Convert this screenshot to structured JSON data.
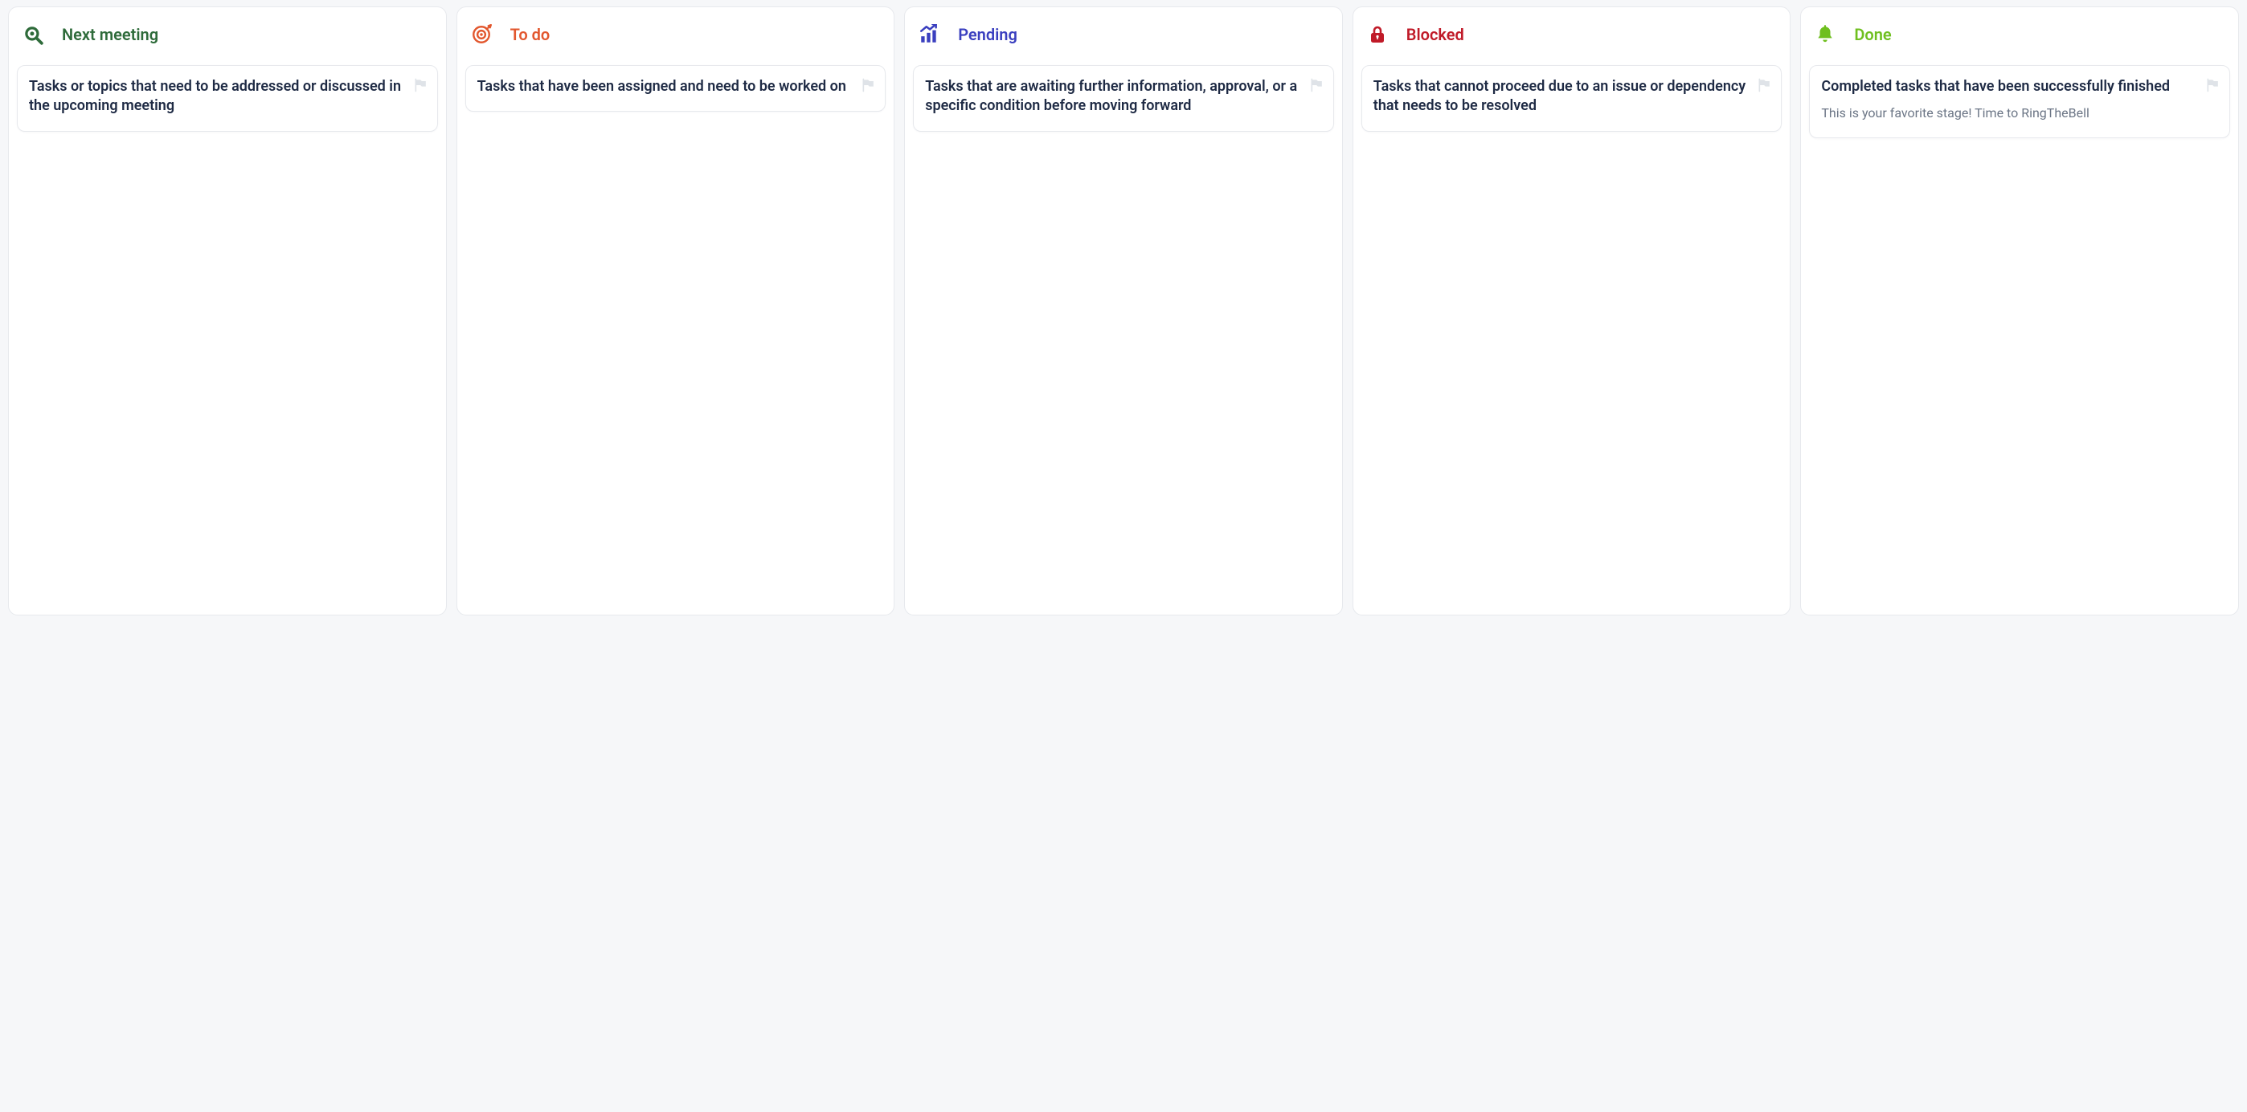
{
  "columns": [
    {
      "id": "next-meeting",
      "title": "Next meeting",
      "icon": "search-icon",
      "color": "#2e6b3a",
      "colorClass": "c-green",
      "card": {
        "title": "Tasks or topics that need to be addressed or discussed in the upcoming meeting",
        "subtitle": ""
      }
    },
    {
      "id": "to-do",
      "title": "To do",
      "icon": "target-icon",
      "color": "#e2572e",
      "colorClass": "c-orange",
      "card": {
        "title": "Tasks that have been assigned and need to be worked on",
        "subtitle": ""
      }
    },
    {
      "id": "pending",
      "title": "Pending",
      "icon": "growth-chart-icon",
      "color": "#3a3fbf",
      "colorClass": "c-blue",
      "card": {
        "title": "Tasks that are awaiting further information, approval, or a specific condition before moving forward",
        "subtitle": ""
      }
    },
    {
      "id": "blocked",
      "title": "Blocked",
      "icon": "lock-icon",
      "color": "#c01a28",
      "colorClass": "c-red",
      "card": {
        "title": "Tasks that cannot proceed due to an issue or dependency that needs to be resolved",
        "subtitle": ""
      }
    },
    {
      "id": "done",
      "title": "Done",
      "icon": "bell-icon",
      "color": "#6fbf1f",
      "colorClass": "c-lime",
      "card": {
        "title": "Completed tasks that have been successfully finished",
        "subtitle": "This is your favorite stage! Time to RingTheBell"
      }
    }
  ]
}
